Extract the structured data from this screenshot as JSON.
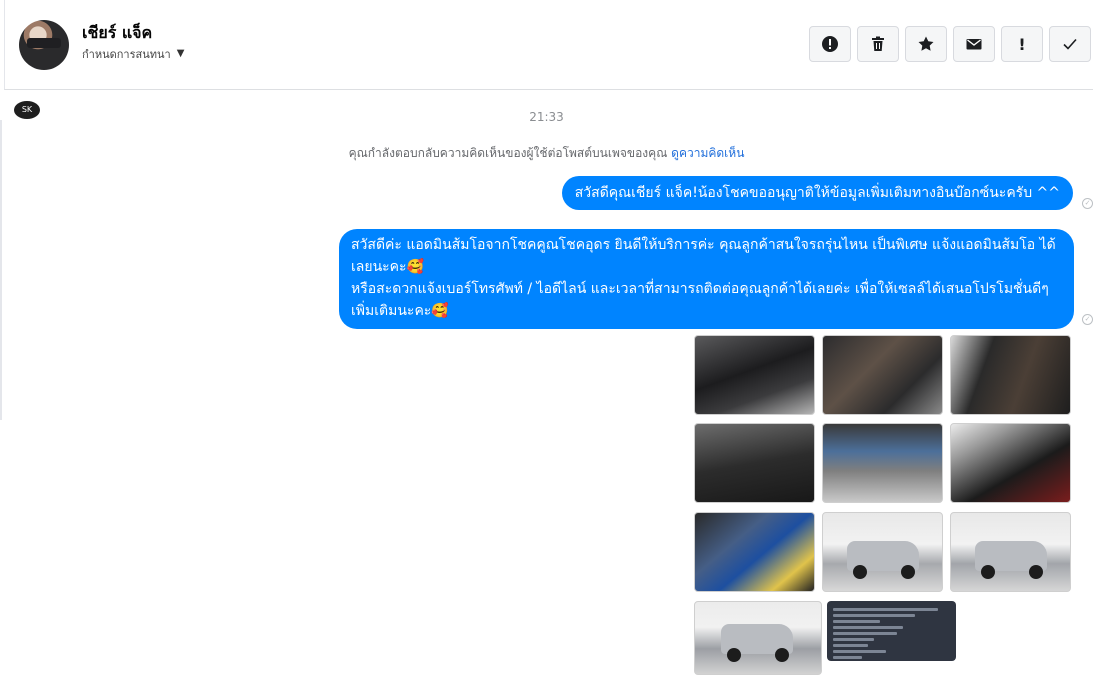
{
  "header": {
    "contact_name": "เชียร์ แจ็ค",
    "subtitle": "กำหนดการสนทนา",
    "actions": [
      {
        "icon": "alert-circle-icon"
      },
      {
        "icon": "trash-icon"
      },
      {
        "icon": "star-icon"
      },
      {
        "icon": "envelope-icon"
      },
      {
        "icon": "exclamation-icon",
        "glyph": "!"
      },
      {
        "icon": "check-icon"
      }
    ]
  },
  "conversation": {
    "time": "21:33",
    "notice_text": "คุณกำลังตอบกลับความคิดเห็นของผู้ใช้ต่อโพสต์บนเพจของคุณ",
    "notice_link": "ดูความคิดเห็น",
    "messages": [
      {
        "text": "สวัสดีคุณเชียร์ แจ็ค!น้องโชคขออนุญาติให้ข้อมูลเพิ่มเติมทางอินบ๊อกซ์นะครับ ^^"
      },
      {
        "text": "สวัสดีค่ะ แอดมินส้มโอจากโชคคูณโชคอุดร ยินดีให้บริการค่ะ   คุณลูกค้าสนใจรถรุ่นไหน เป็นพิเศษ แจ้งแอดมินส้มโอ ได้เลยนะคะ🥰\nหรือสะดวกแจ้งเบอร์โทรศัพท์ / ไอดีไลน์ และเวลาที่สามารถติดต่อคุณลูกค้าได้เลยค่ะ เพื่อให้เซลล์ได้เสนอโปรโมชั่นดีๆเพิ่มเติมนะคะ🥰"
      }
    ],
    "photos": [
      "car-interior-steering",
      "car-leather-seats-front",
      "car-interior-seats",
      "car-dashboard",
      "car-engine-bay",
      "car-rear-cabin",
      "car-battery-engine",
      "silver-pickup-front",
      "silver-pickup-front-angle",
      "silver-pickup-rear",
      "car-info-document"
    ]
  },
  "colors": {
    "bubble": "#0084ff",
    "link": "#216fdb"
  }
}
